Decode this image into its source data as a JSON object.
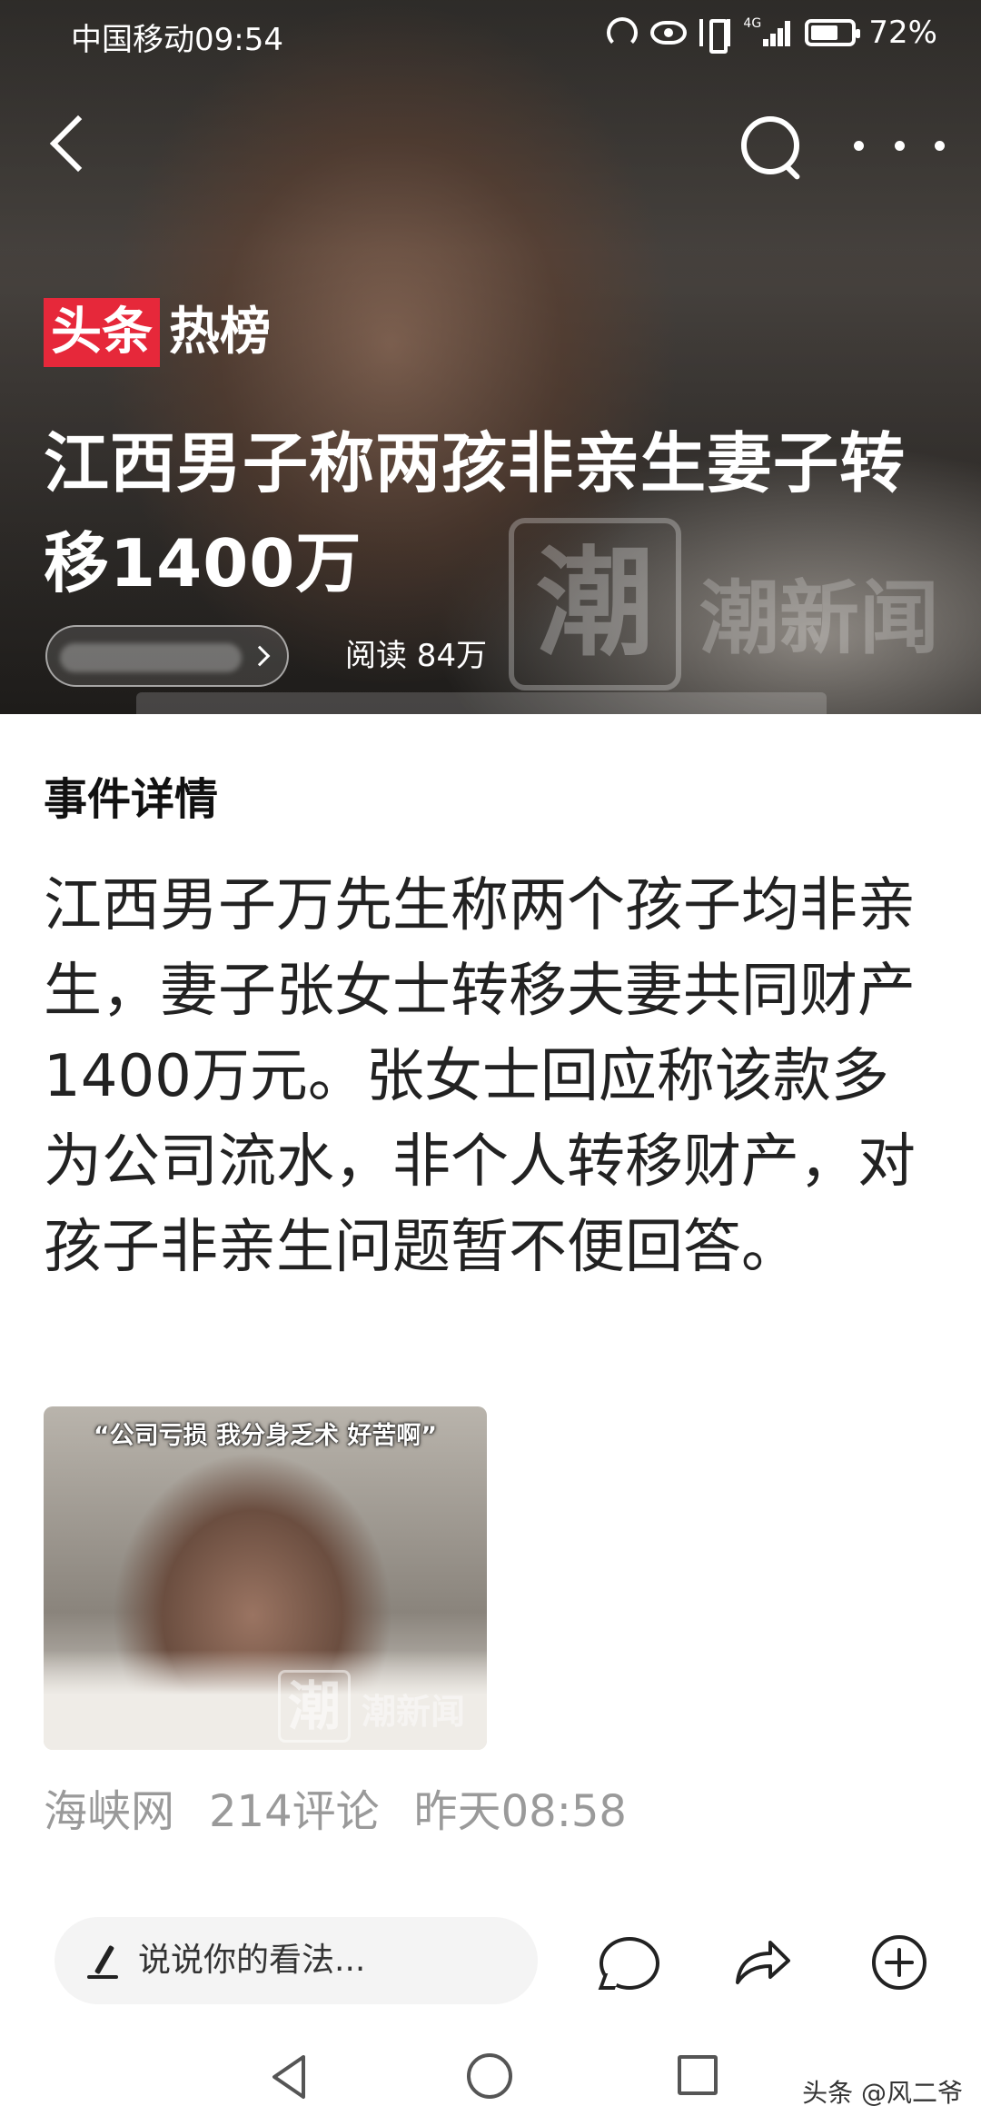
{
  "status_bar": {
    "carrier_time": "中国移动09:54",
    "network_label": "4G",
    "battery": "72%"
  },
  "nav": {
    "back_icon": "chevron-left-icon",
    "search_icon": "search-icon",
    "more_icon": "more-horizontal-icon"
  },
  "brand": {
    "part1": "头条",
    "part2": "热榜",
    "accent_color": "#e6283a"
  },
  "hero": {
    "title": "江西男子称两孩非亲生妻子转移1400万",
    "read_count": "阅读 84万",
    "watermark": "潮",
    "watermark_text": "潮新闻"
  },
  "section": {
    "title": "事件详情"
  },
  "summary": "江西男子万先生称两个孩子均非亲生，妻子张女士转移夫妻共同财产1400万元。张女士回应称该款多为公司流水，非个人转移财产，对孩子非亲生问题暂不便回答。",
  "thumbnail": {
    "caption": "“公司亏损 我分身乏术 好苦啊”",
    "watermark": "潮",
    "watermark_text": "潮新闻"
  },
  "meta": {
    "source": "海峡网",
    "comments": "214评论",
    "time": "昨天08:58"
  },
  "bottom_bar": {
    "comment_placeholder": "说说你的看法...",
    "icons": [
      "comment-icon",
      "share-icon",
      "add-icon"
    ]
  },
  "system_watermark": "头条 @风二爷"
}
